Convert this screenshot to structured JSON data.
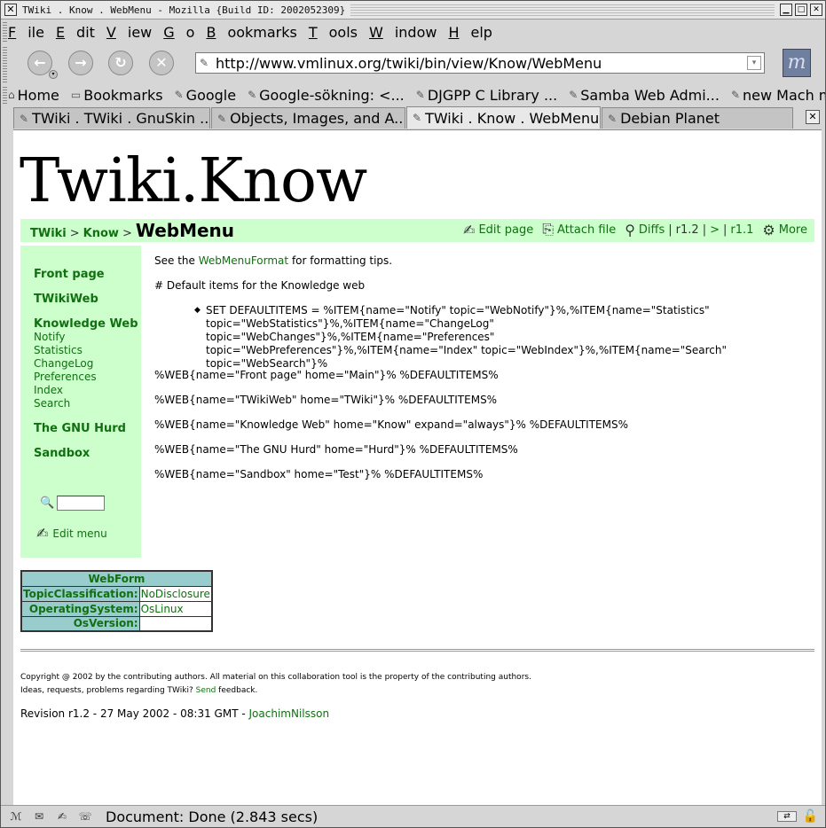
{
  "window": {
    "title": "TWiki . Know . WebMenu - Mozilla {Build ID: 2002052309}"
  },
  "menubar": {
    "items": [
      "File",
      "Edit",
      "View",
      "Go",
      "Bookmarks",
      "Tools",
      "Window",
      "Help"
    ],
    "mnemonics": [
      "F",
      "E",
      "V",
      "G",
      "B",
      "T",
      "W",
      "H"
    ]
  },
  "navbar": {
    "url": "http://www.vmlinux.org/twiki/bin/view/Know/WebMenu",
    "throbber_glyph": "m"
  },
  "bookmarks": {
    "items": [
      "Home",
      "Bookmarks",
      "Google",
      "Google-sökning: <...",
      "DJGPP C Library ...",
      "Samba Web Admi...",
      "new Mach micr"
    ]
  },
  "tabs": {
    "items": [
      "TWiki . TWiki . GnuSkin ...",
      "Objects, Images, and A...",
      "TWiki . Know . WebMenu",
      "Debian Planet"
    ],
    "active_index": 2
  },
  "page": {
    "logo": "Twiki.Know",
    "breadcrumb": {
      "root": "TWiki",
      "sep": ">",
      "web": "Know",
      "current": "WebMenu"
    },
    "actions": {
      "edit": "Edit page",
      "attach": "Attach file",
      "diffs": "Diffs",
      "divider": "|",
      "r12": "r1.2",
      "gt": ">",
      "r11": "r1.1",
      "more": "More"
    },
    "leftmenu": {
      "front_page": "Front page",
      "twikiweb": "TWikiWeb",
      "knowledge_web": "Knowledge Web",
      "sub_items": [
        "Notify",
        "Statistics",
        "ChangeLog",
        "Preferences",
        "Index",
        "Search"
      ],
      "gnu_hurd": "The GNU Hurd",
      "sandbox": "Sandbox",
      "search_value": "",
      "edit_menu": "Edit menu"
    },
    "main": {
      "see_the": "See the",
      "format_link": "WebMenuFormat",
      "format_suffix": "for formatting tips.",
      "comment": "# Default items for the Knowledge web",
      "set_text": "SET DEFAULTITEMS = %ITEM{name=\"Notify\" topic=\"WebNotify\"}%,%ITEM{name=\"Statistics\"\ntopic=\"WebStatistics\"}%,%ITEM{name=\"ChangeLog\" topic=\"WebChanges\"}%,%ITEM{name=\"Preferences\"\ntopic=\"WebPreferences\"}%,%ITEM{name=\"Index\" topic=\"WebIndex\"}%,%ITEM{name=\"Search\"\ntopic=\"WebSearch\"}%",
      "web_lines": [
        "%WEB{name=\"Front page\" home=\"Main\"}% %DEFAULTITEMS%",
        "%WEB{name=\"TWikiWeb\" home=\"TWiki\"}% %DEFAULTITEMS%",
        "%WEB{name=\"Knowledge Web\" home=\"Know\" expand=\"always\"}% %DEFAULTITEMS%",
        "%WEB{name=\"The GNU Hurd\" home=\"Hurd\"}% %DEFAULTITEMS%",
        "%WEB{name=\"Sandbox\" home=\"Test\"}% %DEFAULTITEMS%"
      ]
    },
    "webform": {
      "header": "WebForm",
      "rows": [
        {
          "label": "TopicClassification:",
          "value": "NoDisclosure"
        },
        {
          "label": "OperatingSystem:",
          "value": "OsLinux"
        },
        {
          "label": "OsVersion:",
          "value": ""
        }
      ]
    },
    "footer": {
      "copyright": "Copyright @ 2002 by the contributing authors. All material on this collaboration tool is the property of the contributing authors.",
      "ideas_prefix": "Ideas, requests, problems regarding TWiki?",
      "send": "Send",
      "ideas_suffix": "feedback.",
      "revision_prefix": "Revision r1.2 - 27 May 2002 - 08:31 GMT -",
      "author": "JoachimNilsson"
    }
  },
  "status": {
    "text": "Document: Done (2.843 secs)"
  },
  "colors": {
    "twiki_green_bg": "#ccffcc",
    "link_green": "#107010",
    "webform_teal": "#99cccc"
  }
}
